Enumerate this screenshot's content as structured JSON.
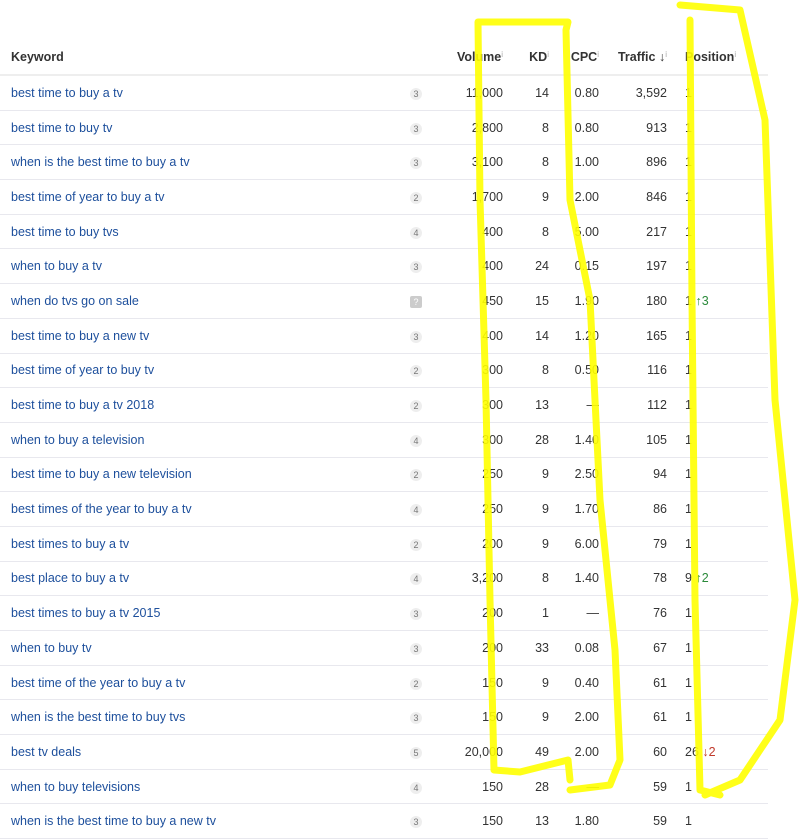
{
  "headers": {
    "keyword": "Keyword",
    "volume": "Volume",
    "kd": "KD",
    "cpc": "CPC",
    "traffic": "Traffic",
    "traffic_sort": "↓",
    "position": "Position",
    "info": "i"
  },
  "rows": [
    {
      "keyword": "best time to buy a tv",
      "badge": "3",
      "volume": "11,000",
      "kd": "14",
      "cpc": "0.80",
      "traffic": "3,592",
      "position": "1",
      "change": "",
      "dir": ""
    },
    {
      "keyword": "best time to buy tv",
      "badge": "3",
      "volume": "2,800",
      "kd": "8",
      "cpc": "0.80",
      "traffic": "913",
      "position": "1",
      "change": "",
      "dir": ""
    },
    {
      "keyword": "when is the best time to buy a tv",
      "badge": "3",
      "volume": "3,100",
      "kd": "8",
      "cpc": "1.00",
      "traffic": "896",
      "position": "1",
      "change": "",
      "dir": ""
    },
    {
      "keyword": "best time of year to buy a tv",
      "badge": "2",
      "volume": "1,700",
      "kd": "9",
      "cpc": "2.00",
      "traffic": "846",
      "position": "1",
      "change": "",
      "dir": ""
    },
    {
      "keyword": "best time to buy tvs",
      "badge": "4",
      "volume": "400",
      "kd": "8",
      "cpc": "5.00",
      "traffic": "217",
      "position": "1",
      "change": "",
      "dir": ""
    },
    {
      "keyword": "when to buy a tv",
      "badge": "3",
      "volume": "400",
      "kd": "24",
      "cpc": "0.15",
      "traffic": "197",
      "position": "1",
      "change": "",
      "dir": ""
    },
    {
      "keyword": "when do tvs go on sale",
      "badge": "?",
      "volume": "450",
      "kd": "15",
      "cpc": "1.90",
      "traffic": "180",
      "position": "1",
      "change": "↑3",
      "dir": "up"
    },
    {
      "keyword": "best time to buy a new tv",
      "badge": "3",
      "volume": "400",
      "kd": "14",
      "cpc": "1.20",
      "traffic": "165",
      "position": "1",
      "change": "",
      "dir": ""
    },
    {
      "keyword": "best time of year to buy tv",
      "badge": "2",
      "volume": "300",
      "kd": "8",
      "cpc": "0.50",
      "traffic": "116",
      "position": "1",
      "change": "",
      "dir": ""
    },
    {
      "keyword": "best time to buy a tv 2018",
      "badge": "2",
      "volume": "300",
      "kd": "13",
      "cpc": "—",
      "traffic": "112",
      "position": "1",
      "change": "",
      "dir": ""
    },
    {
      "keyword": "when to buy a television",
      "badge": "4",
      "volume": "300",
      "kd": "28",
      "cpc": "1.40",
      "traffic": "105",
      "position": "1",
      "change": "",
      "dir": ""
    },
    {
      "keyword": "best time to buy a new television",
      "badge": "2",
      "volume": "250",
      "kd": "9",
      "cpc": "2.50",
      "traffic": "94",
      "position": "1",
      "change": "",
      "dir": ""
    },
    {
      "keyword": "best times of the year to buy a tv",
      "badge": "4",
      "volume": "250",
      "kd": "9",
      "cpc": "1.70",
      "traffic": "86",
      "position": "1",
      "change": "",
      "dir": ""
    },
    {
      "keyword": "best times to buy a tv",
      "badge": "2",
      "volume": "200",
      "kd": "9",
      "cpc": "6.00",
      "traffic": "79",
      "position": "1",
      "change": "",
      "dir": ""
    },
    {
      "keyword": "best place to buy a tv",
      "badge": "4",
      "volume": "3,200",
      "kd": "8",
      "cpc": "1.40",
      "traffic": "78",
      "position": "9",
      "change": "↑2",
      "dir": "up"
    },
    {
      "keyword": "best times to buy a tv 2015",
      "badge": "3",
      "volume": "200",
      "kd": "1",
      "cpc": "—",
      "traffic": "76",
      "position": "1",
      "change": "",
      "dir": ""
    },
    {
      "keyword": "when to buy tv",
      "badge": "3",
      "volume": "200",
      "kd": "33",
      "cpc": "0.08",
      "traffic": "67",
      "position": "1",
      "change": "",
      "dir": ""
    },
    {
      "keyword": "best time of the year to buy a tv",
      "badge": "2",
      "volume": "150",
      "kd": "9",
      "cpc": "0.40",
      "traffic": "61",
      "position": "1",
      "change": "",
      "dir": ""
    },
    {
      "keyword": "when is the best time to buy tvs",
      "badge": "3",
      "volume": "150",
      "kd": "9",
      "cpc": "2.00",
      "traffic": "61",
      "position": "1",
      "change": "",
      "dir": ""
    },
    {
      "keyword": "best tv deals",
      "badge": "5",
      "volume": "20,000",
      "kd": "49",
      "cpc": "2.00",
      "traffic": "60",
      "position": "26",
      "change": "↓2",
      "dir": "down"
    },
    {
      "keyword": "when to buy televisions",
      "badge": "4",
      "volume": "150",
      "kd": "28",
      "cpc": "—",
      "traffic": "59",
      "position": "1",
      "change": "",
      "dir": ""
    },
    {
      "keyword": "when is the best time to buy a new tv",
      "badge": "3",
      "volume": "150",
      "kd": "13",
      "cpc": "1.80",
      "traffic": "59",
      "position": "1",
      "change": "",
      "dir": ""
    }
  ],
  "colors": {
    "link": "#1d4f9c",
    "highlight": "#ffff00",
    "up": "#2a8a3a",
    "down": "#c0392b"
  }
}
